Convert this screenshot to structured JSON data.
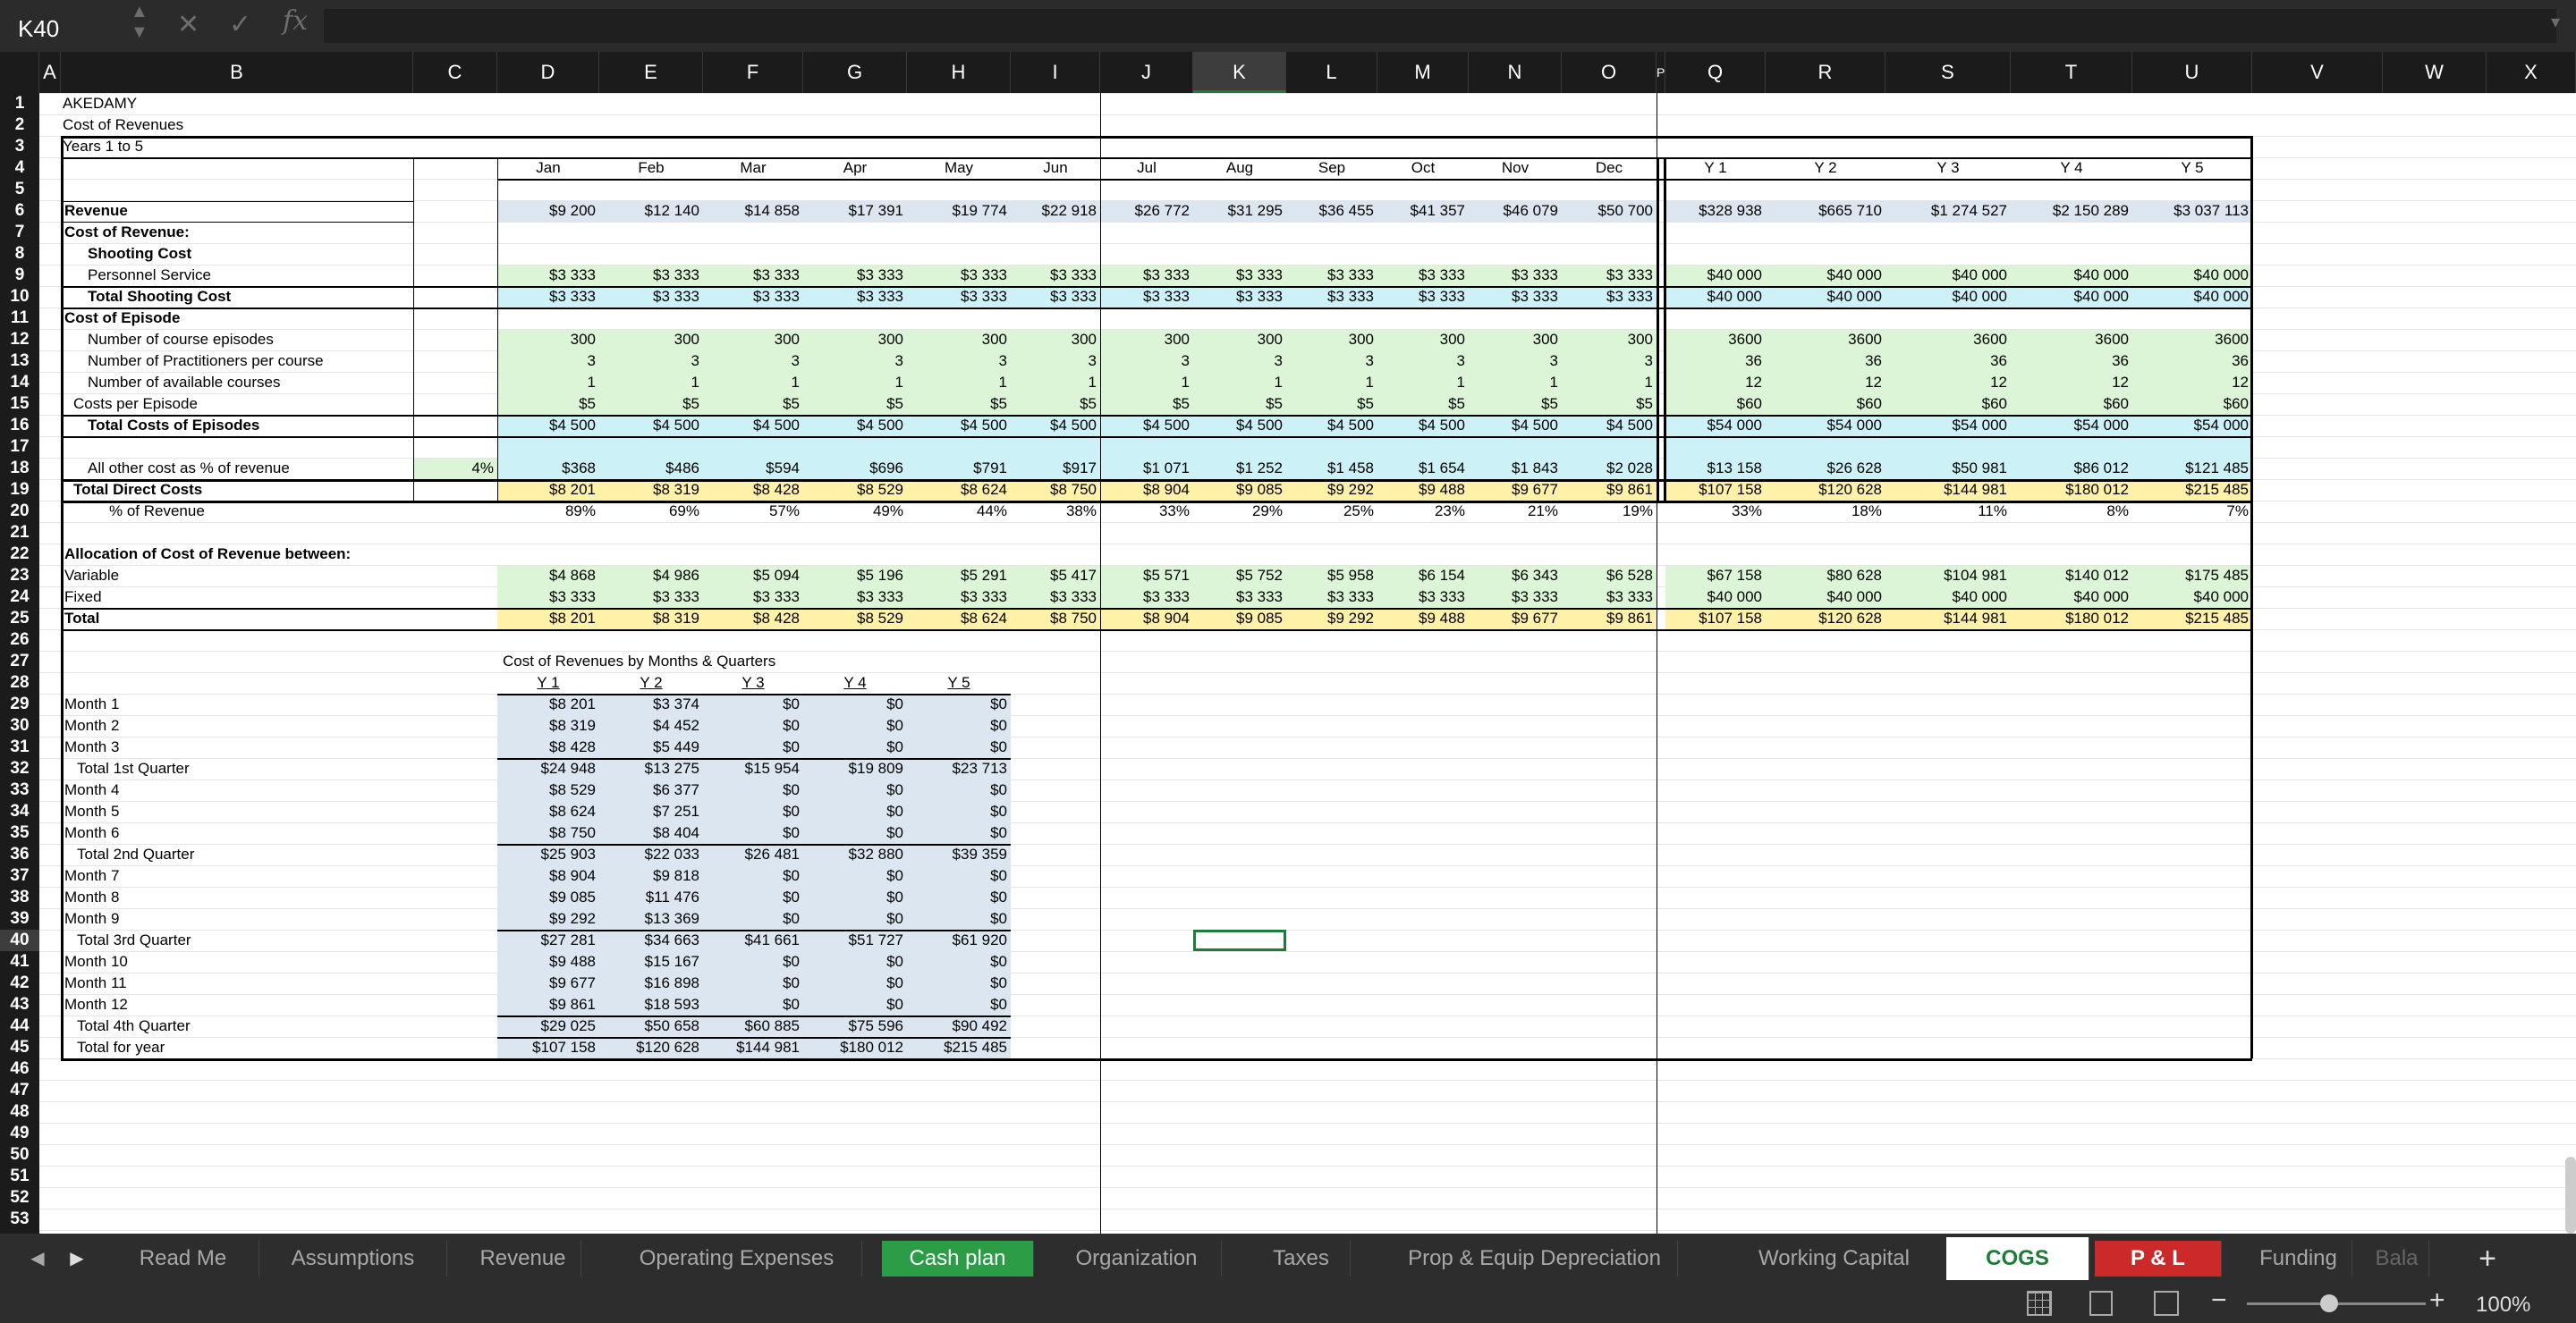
{
  "formula_bar": {
    "name_box": "K40",
    "formula": ""
  },
  "columns": [
    "A",
    "B",
    "C",
    "D",
    "E",
    "F",
    "G",
    "H",
    "I",
    "J",
    "K",
    "L",
    "M",
    "N",
    "O",
    "P",
    "Q",
    "R",
    "S",
    "T",
    "U",
    "V",
    "W",
    "X"
  ],
  "row_numbers": [
    "1",
    "2",
    "3",
    "4",
    "5",
    "6",
    "7",
    "8",
    "9",
    "10",
    "11",
    "12",
    "13",
    "14",
    "15",
    "16",
    "17",
    "18",
    "19",
    "20",
    "21",
    "22",
    "23",
    "24",
    "25",
    "26",
    "27",
    "28",
    "29",
    "30",
    "31",
    "32",
    "33",
    "34",
    "35",
    "36",
    "37",
    "38",
    "39",
    "40",
    "41",
    "42",
    "43",
    "44",
    "45",
    "46",
    "47",
    "48",
    "49",
    "50",
    "51",
    "52",
    "53"
  ],
  "colors": {
    "green_fill": "#dcf5d6",
    "blue_fill": "#dce6f1",
    "cyan_fill": "#ccf2f8",
    "yellow_fill": "#fff2a8",
    "active_tab": "#1e7c3a",
    "red_tab": "#cc2a2a",
    "cashplan_tab": "#2b9d47",
    "selected_cell": "#1e7c3a"
  },
  "sheet": {
    "title": "AKEDAMY",
    "subtitle": "Cost of Revenues",
    "years": "Years 1 to 5",
    "month_headers": [
      "Jan",
      "Feb",
      "Mar",
      "Apr",
      "May",
      "Jun",
      "Jul",
      "Aug",
      "Sep",
      "Oct",
      "Nov",
      "Dec",
      "Y 1",
      "Y 2",
      "Y 3",
      "Y 4",
      "Y 5"
    ],
    "pct_input": "4%",
    "rows": [
      {
        "r": 6,
        "label": "Revenue",
        "values": [
          "$9 200",
          "$12 140",
          "$14 858",
          "$17 391",
          "$19 774",
          "$22 918",
          "$26 772",
          "$31 295",
          "$36 455",
          "$41 357",
          "$46 079",
          "$50 700",
          "$328 938",
          "$665 710",
          "$1 274 527",
          "$2 150 289",
          "$3 037 113"
        ]
      },
      {
        "r": 7,
        "label": "Cost of Revenue:"
      },
      {
        "r": 8,
        "label": "Shooting Cost"
      },
      {
        "r": 9,
        "label": "Personnel Service",
        "values": [
          "$3 333",
          "$3 333",
          "$3 333",
          "$3 333",
          "$3 333",
          "$3 333",
          "$3 333",
          "$3 333",
          "$3 333",
          "$3 333",
          "$3 333",
          "$3 333",
          "$40 000",
          "$40 000",
          "$40 000",
          "$40 000",
          "$40 000"
        ]
      },
      {
        "r": 10,
        "label": "Total Shooting Cost",
        "values": [
          "$3 333",
          "$3 333",
          "$3 333",
          "$3 333",
          "$3 333",
          "$3 333",
          "$3 333",
          "$3 333",
          "$3 333",
          "$3 333",
          "$3 333",
          "$3 333",
          "$40 000",
          "$40 000",
          "$40 000",
          "$40 000",
          "$40 000"
        ]
      },
      {
        "r": 11,
        "label": "Cost of Episode"
      },
      {
        "r": 12,
        "label": "Number of course episodes",
        "values": [
          "300",
          "300",
          "300",
          "300",
          "300",
          "300",
          "300",
          "300",
          "300",
          "300",
          "300",
          "300",
          "3600",
          "3600",
          "3600",
          "3600",
          "3600"
        ]
      },
      {
        "r": 13,
        "label": "Number of Practitioners per course",
        "values": [
          "3",
          "3",
          "3",
          "3",
          "3",
          "3",
          "3",
          "3",
          "3",
          "3",
          "3",
          "3",
          "36",
          "36",
          "36",
          "36",
          "36"
        ]
      },
      {
        "r": 14,
        "label": "Number of available courses",
        "values": [
          "1",
          "1",
          "1",
          "1",
          "1",
          "1",
          "1",
          "1",
          "1",
          "1",
          "1",
          "1",
          "12",
          "12",
          "12",
          "12",
          "12"
        ]
      },
      {
        "r": 15,
        "label": "Costs per Episode",
        "values": [
          "$5",
          "$5",
          "$5",
          "$5",
          "$5",
          "$5",
          "$5",
          "$5",
          "$5",
          "$5",
          "$5",
          "$5",
          "$60",
          "$60",
          "$60",
          "$60",
          "$60"
        ]
      },
      {
        "r": 16,
        "label": "Total Costs of Episodes",
        "values": [
          "$4 500",
          "$4 500",
          "$4 500",
          "$4 500",
          "$4 500",
          "$4 500",
          "$4 500",
          "$4 500",
          "$4 500",
          "$4 500",
          "$4 500",
          "$4 500",
          "$54 000",
          "$54 000",
          "$54 000",
          "$54 000",
          "$54 000"
        ]
      },
      {
        "r": 18,
        "label": "All other cost as % of revenue",
        "values": [
          "$368",
          "$486",
          "$594",
          "$696",
          "$791",
          "$917",
          "$1 071",
          "$1 252",
          "$1 458",
          "$1 654",
          "$1 843",
          "$2 028",
          "$13 158",
          "$26 628",
          "$50 981",
          "$86 012",
          "$121 485"
        ]
      },
      {
        "r": 19,
        "label": "Total Direct Costs",
        "values": [
          "$8 201",
          "$8 319",
          "$8 428",
          "$8 529",
          "$8 624",
          "$8 750",
          "$8 904",
          "$9 085",
          "$9 292",
          "$9 488",
          "$9 677",
          "$9 861",
          "$107 158",
          "$120 628",
          "$144 981",
          "$180 012",
          "$215 485"
        ]
      },
      {
        "r": 20,
        "label": "% of Revenue",
        "values": [
          "89%",
          "69%",
          "57%",
          "49%",
          "44%",
          "38%",
          "33%",
          "29%",
          "25%",
          "23%",
          "21%",
          "19%",
          "33%",
          "18%",
          "11%",
          "8%",
          "7%"
        ]
      },
      {
        "r": 22,
        "label": "Allocation of Cost of Revenue between:"
      },
      {
        "r": 23,
        "label": "Variable",
        "values": [
          "$4 868",
          "$4 986",
          "$5 094",
          "$5 196",
          "$5 291",
          "$5 417",
          "$5 571",
          "$5 752",
          "$5 958",
          "$6 154",
          "$6 343",
          "$6 528",
          "$67 158",
          "$80 628",
          "$104 981",
          "$140 012",
          "$175 485"
        ]
      },
      {
        "r": 24,
        "label": "Fixed",
        "values": [
          "$3 333",
          "$3 333",
          "$3 333",
          "$3 333",
          "$3 333",
          "$3 333",
          "$3 333",
          "$3 333",
          "$3 333",
          "$3 333",
          "$3 333",
          "$3 333",
          "$40 000",
          "$40 000",
          "$40 000",
          "$40 000",
          "$40 000"
        ]
      },
      {
        "r": 25,
        "label": "Total",
        "values": [
          "$8 201",
          "$8 319",
          "$8 428",
          "$8 529",
          "$8 624",
          "$8 750",
          "$8 904",
          "$9 085",
          "$9 292",
          "$9 488",
          "$9 677",
          "$9 861",
          "$107 158",
          "$120 628",
          "$144 981",
          "$180 012",
          "$215 485"
        ]
      }
    ],
    "quarters": {
      "title": "Cost of Revenues by Months & Quarters",
      "headers": [
        "Y 1",
        "Y 2",
        "Y 3",
        "Y 4",
        "Y 5"
      ],
      "rows": [
        {
          "label": "Month 1",
          "values": [
            "$8 201",
            "$3 374",
            "$0",
            "$0",
            "$0"
          ]
        },
        {
          "label": "Month 2",
          "values": [
            "$8 319",
            "$4 452",
            "$0",
            "$0",
            "$0"
          ]
        },
        {
          "label": "Month 3",
          "values": [
            "$8 428",
            "$5 449",
            "$0",
            "$0",
            "$0"
          ]
        },
        {
          "label": "Total 1st Quarter",
          "values": [
            "$24 948",
            "$13 275",
            "$15 954",
            "$19 809",
            "$23 713"
          ]
        },
        {
          "label": "Month 4",
          "values": [
            "$8 529",
            "$6 377",
            "$0",
            "$0",
            "$0"
          ]
        },
        {
          "label": "Month 5",
          "values": [
            "$8 624",
            "$7 251",
            "$0",
            "$0",
            "$0"
          ]
        },
        {
          "label": "Month 6",
          "values": [
            "$8 750",
            "$8 404",
            "$0",
            "$0",
            "$0"
          ]
        },
        {
          "label": "Total 2nd Quarter",
          "values": [
            "$25 903",
            "$22 033",
            "$26 481",
            "$32 880",
            "$39 359"
          ]
        },
        {
          "label": "Month 7",
          "values": [
            "$8 904",
            "$9 818",
            "$0",
            "$0",
            "$0"
          ]
        },
        {
          "label": "Month 8",
          "values": [
            "$9 085",
            "$11 476",
            "$0",
            "$0",
            "$0"
          ]
        },
        {
          "label": "Month 9",
          "values": [
            "$9 292",
            "$13 369",
            "$0",
            "$0",
            "$0"
          ]
        },
        {
          "label": "Total 3rd Quarter",
          "values": [
            "$27 281",
            "$34 663",
            "$41 661",
            "$51 727",
            "$61 920"
          ]
        },
        {
          "label": "Month 10",
          "values": [
            "$9 488",
            "$15 167",
            "$0",
            "$0",
            "$0"
          ]
        },
        {
          "label": "Month 11",
          "values": [
            "$9 677",
            "$16 898",
            "$0",
            "$0",
            "$0"
          ]
        },
        {
          "label": "Month 12",
          "values": [
            "$9 861",
            "$18 593",
            "$0",
            "$0",
            "$0"
          ]
        },
        {
          "label": "Total 4th Quarter",
          "values": [
            "$29 025",
            "$50 658",
            "$60 885",
            "$75 596",
            "$90 492"
          ]
        },
        {
          "label": "Total for year",
          "values": [
            "$107 158",
            "$120 628",
            "$144 981",
            "$180 012",
            "$215 485"
          ]
        }
      ]
    }
  },
  "tabs": [
    "Read Me",
    "Assumptions",
    "Revenue",
    "Operating Expenses",
    "Cash plan",
    "Organization",
    "Taxes",
    "Prop & Equip Depreciation",
    "Working Capital",
    "COGS",
    "P & L",
    "Funding",
    "Bala"
  ],
  "status": {
    "zoom": "100%"
  }
}
